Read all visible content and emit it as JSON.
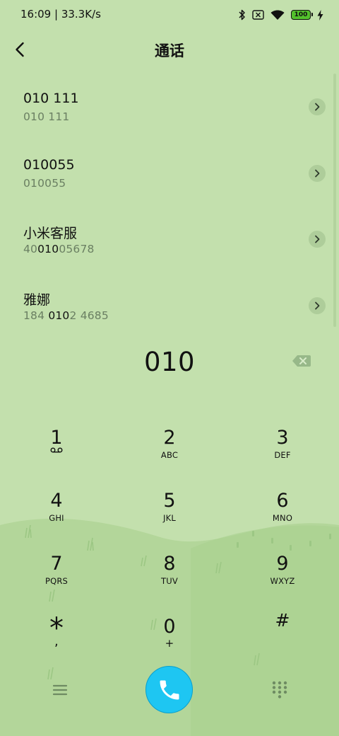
{
  "status_bar": {
    "time_speed": "16:09 | 33.3K/s",
    "battery": "100",
    "icons": [
      "bluetooth-icon",
      "no-sim-icon",
      "wifi-icon",
      "battery-icon",
      "charging-icon"
    ]
  },
  "header": {
    "title": "通话",
    "back_icon": "chevron-left-icon"
  },
  "contacts": [
    {
      "name": "010 111",
      "number": [
        {
          "t": "010 111",
          "hl": false
        }
      ]
    },
    {
      "name": "010055",
      "number": [
        {
          "t": "010055",
          "hl": false
        }
      ]
    },
    {
      "name": "小米客服",
      "number": [
        {
          "t": "40",
          "hl": false
        },
        {
          "t": "010",
          "hl": true
        },
        {
          "t": "05678",
          "hl": false
        }
      ]
    },
    {
      "name": "雅娜",
      "number": [
        {
          "t": "184 ",
          "hl": false
        },
        {
          "t": "010",
          "hl": true
        },
        {
          "t": "2 4685",
          "hl": false
        }
      ]
    }
  ],
  "dialer": {
    "digits": "010"
  },
  "keypad": [
    {
      "digit": "1",
      "letters": ""
    },
    {
      "digit": "2",
      "letters": "ABC"
    },
    {
      "digit": "3",
      "letters": "DEF"
    },
    {
      "digit": "4",
      "letters": "GHI"
    },
    {
      "digit": "5",
      "letters": "JKL"
    },
    {
      "digit": "6",
      "letters": "MNO"
    },
    {
      "digit": "7",
      "letters": "PQRS"
    },
    {
      "digit": "8",
      "letters": "TUV"
    },
    {
      "digit": "9",
      "letters": "WXYZ"
    },
    {
      "digit": "*",
      "letters": ","
    },
    {
      "digit": "0",
      "letters": "+"
    },
    {
      "digit": "#",
      "letters": ""
    }
  ],
  "colors": {
    "background": "#c3e0ad",
    "hill": "#b3d69a",
    "call_button": "#1ec6f2",
    "muted_text": "#6a7f62"
  }
}
